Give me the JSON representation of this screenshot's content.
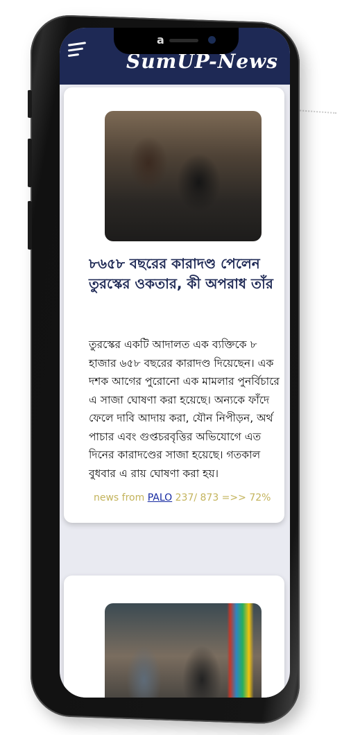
{
  "app": {
    "title": "SumUP-News"
  },
  "notch": {
    "logo": "a"
  },
  "articles": [
    {
      "image_alt": "news-photo",
      "headline": "৮৬৫৮ বছরের কারাদণ্ড পেলেন তুরস্কের ওকতার, কী অপরাধ তাঁর",
      "summary": "তুরস্কের একটি আদালত এক ব্যক্তিকে ৮ হাজার ৬৫৮ বছরের কারাদণ্ড দিয়েছেন। এক দশক আগের পুরোনো এক মামলার পুনর্বিচারে এ সাজা ঘোষণা করা হয়েছে। অন্যকে ফাঁদে ফেলে দাবি আদায় করা, যৌন নিপীড়ন, অর্থ পাচার এবং গুপ্তচরবৃত্তির অভিযোগে এত দিনের কারাদণ্ডের সাজা হয়েছে। গতকাল বুধবার এ রায় ঘোষণা করা হয়।",
      "source_prefix": "news from",
      "source_name": "PALO",
      "source_stats": "237/ 873 =>> 72%"
    },
    {
      "image_alt": "news-photo"
    }
  ],
  "colors": {
    "header": "#1e2955",
    "headline": "#1e2955",
    "source_text": "#c3b35b",
    "link": "#1428a0"
  }
}
